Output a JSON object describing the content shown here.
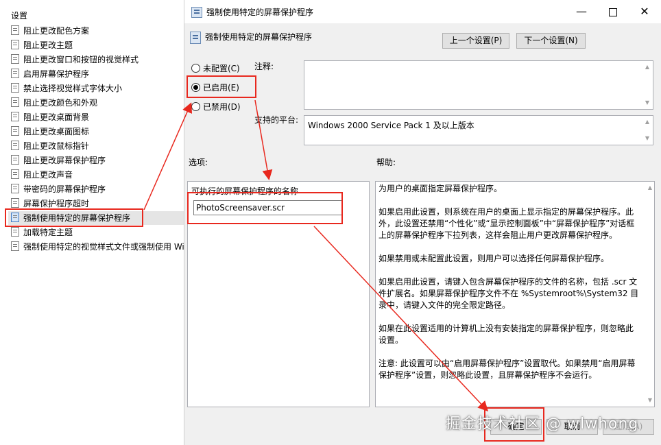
{
  "left_panel": {
    "header": "设置",
    "items": [
      {
        "label": "阻止更改配色方案"
      },
      {
        "label": "阻止更改主题"
      },
      {
        "label": "阻止更改窗口和按钮的视觉样式"
      },
      {
        "label": "启用屏幕保护程序"
      },
      {
        "label": "禁止选择视觉样式字体大小"
      },
      {
        "label": "阻止更改颜色和外观"
      },
      {
        "label": "阻止更改桌面背景"
      },
      {
        "label": "阻止更改桌面图标"
      },
      {
        "label": "阻止更改鼠标指针"
      },
      {
        "label": "阻止更改屏幕保护程序"
      },
      {
        "label": "阻止更改声音"
      },
      {
        "label": "带密码的屏幕保护程序"
      },
      {
        "label": "屏幕保护程序超时"
      },
      {
        "label": "强制使用特定的屏幕保护程序"
      },
      {
        "label": "加载特定主题"
      },
      {
        "label": "强制使用特定的视觉样式文件或强制使用 Wi"
      }
    ]
  },
  "dialog": {
    "title": "强制使用特定的屏幕保护程序",
    "policy_name": "强制使用特定的屏幕保护程序",
    "prev_button": "上一个设置(P)",
    "next_button": "下一个设置(N)",
    "radio_unconfigured": "未配置(C)",
    "radio_enabled": "已启用(E)",
    "radio_disabled": "已禁用(D)",
    "selected_radio": "enabled",
    "comment_label": "注释:",
    "comment_value": "",
    "platform_label": "支持的平台:",
    "platform_value": "Windows 2000 Service Pack 1 及以上版本",
    "options_label": "选项:",
    "help_label": "帮助:",
    "exe_label": "可执行的屏幕保护程序的名称",
    "exe_value": "PhotoScreensaver.scr",
    "help_paragraphs": [
      "为用户的桌面指定屏幕保护程序。",
      "如果启用此设置，则系统在用户的桌面上显示指定的屏幕保护程序。此外，此设置还禁用“个性化”或“显示控制面板”中“屏幕保护程序”对话框上的屏幕保护程序下拉列表，这样会阻止用户更改屏幕保护程序。",
      "如果禁用或未配置此设置，则用户可以选择任何屏幕保护程序。",
      "如果启用此设置，请键入包含屏幕保护程序的文件的名称，包括 .scr 文件扩展名。如果屏幕保护程序文件不在 %Systemroot%\\System32 目录中，请键入文件的完全限定路径。",
      "如果在此设置适用的计算机上没有安装指定的屏幕保护程序，则忽略此设置。",
      "注意: 此设置可以由“启用屏幕保护程序”设置取代。如果禁用“启用屏幕保护程序”设置，则忽略此设置，且屏幕保护程序不会运行。"
    ],
    "ok_button": "确定",
    "cancel_button": "取消",
    "apply_button": "应用(A)"
  },
  "watermark": "掘金技术社区 @ wlwhong",
  "colors": {
    "annotation_red": "#e8281e",
    "dialog_bg": "#f0f0f0"
  }
}
